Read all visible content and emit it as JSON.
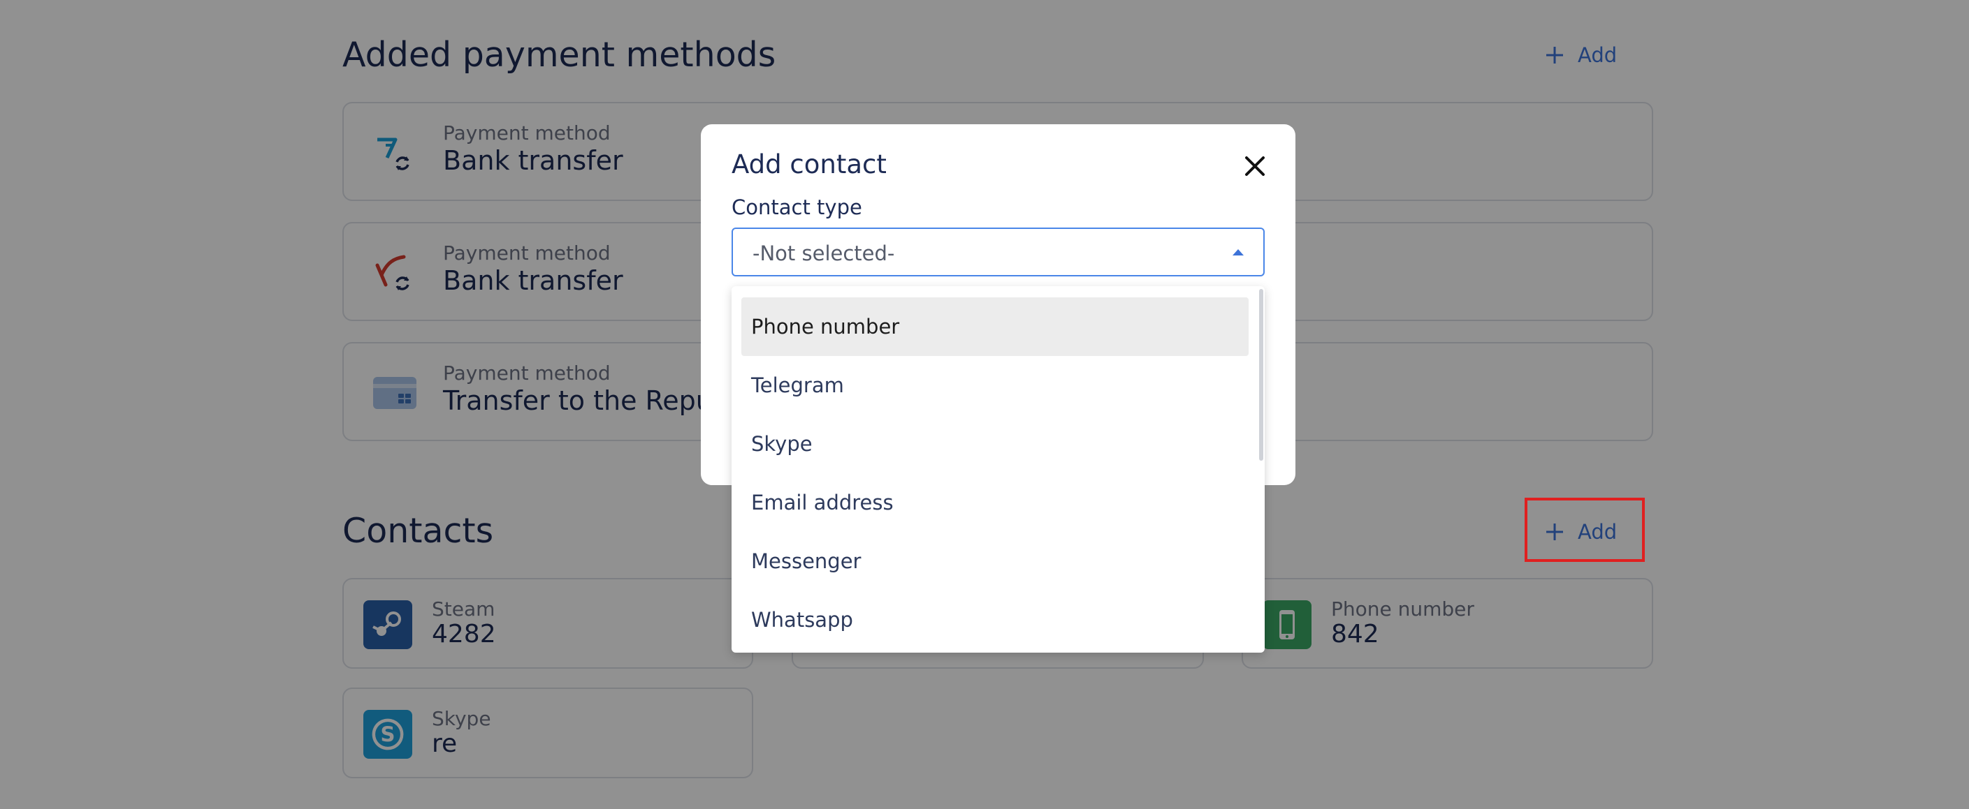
{
  "payment_section": {
    "title": "Added payment methods",
    "add_label": "Add",
    "cards": [
      {
        "label": "Payment method",
        "value": "Bank transfer",
        "icon": "wise-transfer-icon"
      },
      {
        "label": "Payment method",
        "value": "Bank transfer",
        "icon": "yandex-transfer-icon"
      },
      {
        "label": "Payment method",
        "value": "Transfer to the Repul",
        "icon": "bank-card-icon"
      }
    ]
  },
  "contacts_section": {
    "title": "Contacts",
    "add_label": "Add",
    "cards": [
      {
        "label": "Steam",
        "value": "4282",
        "icon": "steam-icon",
        "color": "#2a5fa8"
      },
      {
        "label": "Phone number",
        "value": "842",
        "icon": "phone-icon",
        "color": "#3aa864"
      },
      {
        "label": "Skype",
        "value": "re",
        "icon": "skype-icon",
        "color": "#1ea1dc"
      }
    ]
  },
  "modal": {
    "title": "Add contact",
    "field_label": "Contact type",
    "select_value": "-Not selected-"
  },
  "dropdown": {
    "options": [
      "Phone number",
      "Telegram",
      "Skype",
      "Email address",
      "Messenger",
      "Whatsapp"
    ],
    "highlighted_index": 0
  },
  "colors": {
    "accent": "#3d73d8",
    "title": "#1d2b55",
    "highlight": "#e02020"
  }
}
